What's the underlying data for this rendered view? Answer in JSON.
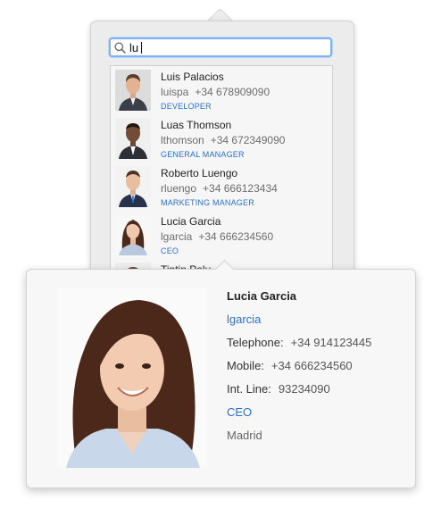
{
  "search": {
    "value": "lu"
  },
  "results": [
    {
      "name": "Luis Palacios",
      "username": "luispa",
      "phone": "+34 678909090",
      "role": "DEVELOPER"
    },
    {
      "name": "Luas Thomson",
      "username": "lthomson",
      "phone": "+34 672349090",
      "role": "GENERAL MANAGER"
    },
    {
      "name": "Roberto Luengo",
      "username": "rluengo",
      "phone": "+34 666123434",
      "role": "MARKETING MANAGER"
    },
    {
      "name": "Lucia Garcia",
      "username": "lgarcia",
      "phone": "+34 666234560",
      "role": "CEO"
    },
    {
      "name": "Tintin Palu",
      "username": "",
      "phone": "",
      "role": ""
    }
  ],
  "detail": {
    "name": "Lucia Garcia",
    "username": "lgarcia",
    "telephone_label": "Telephone:",
    "telephone": "+34 914123445",
    "mobile_label": "Mobile:",
    "mobile": "+34 666234560",
    "intline_label": "Int. Line:",
    "intline": "93234090",
    "role": "CEO",
    "city": "Madrid"
  },
  "colors": {
    "accent": "#2a6fd1",
    "focus_ring": "#7fb0f0"
  },
  "icons": {
    "search": "magnifier-icon"
  }
}
